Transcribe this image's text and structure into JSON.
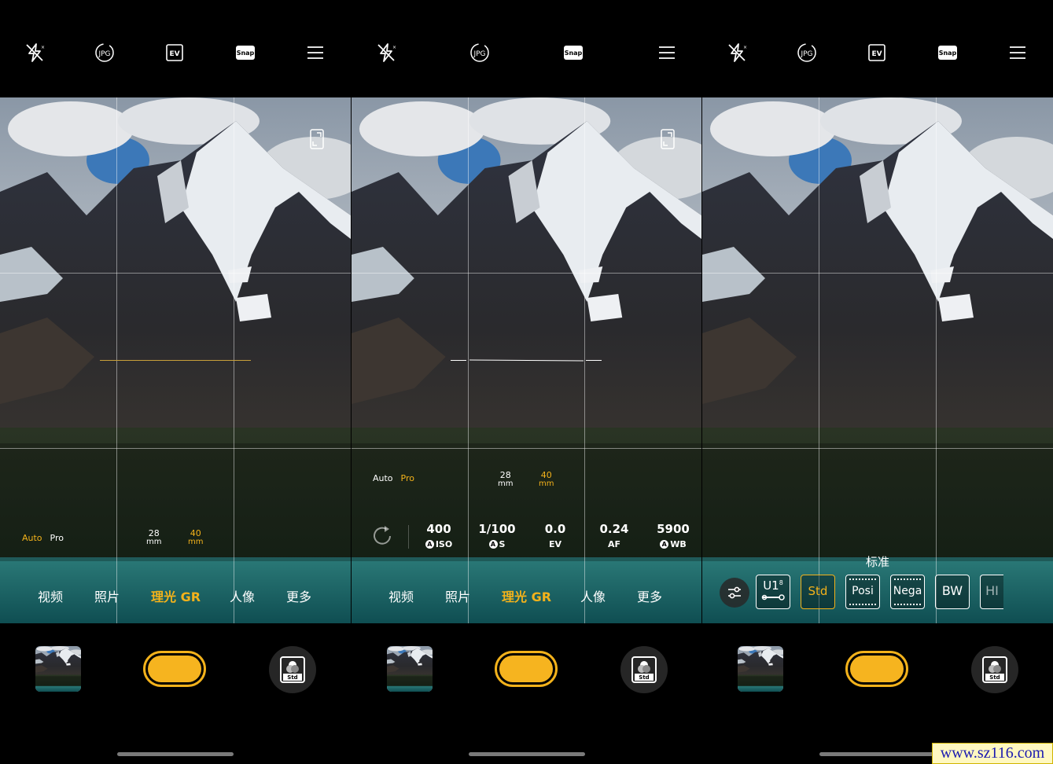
{
  "icons": {
    "top_bar": [
      "flash-off-icon",
      "jpg-format-icon",
      "ev-icon",
      "snap-icon",
      "menu-icon"
    ],
    "bottom_bar": [
      "gallery-thumbnail",
      "shutter-button",
      "film-simulation-icon"
    ]
  },
  "top_labels": {
    "jpg": "JPG",
    "ev": "EV",
    "snap": "Snap"
  },
  "panel1": {
    "modes": [
      "视频",
      "照片",
      "理光 GR",
      "人像",
      "更多"
    ],
    "active_mode": "理光 GR",
    "auto_label": "Auto",
    "pro_label": "Pro",
    "focal_a": {
      "value": "28",
      "unit": "mm"
    },
    "focal_b": {
      "value": "40",
      "unit": "mm"
    },
    "film_label": "Std"
  },
  "panel2": {
    "modes": [
      "视频",
      "照片",
      "理光 GR",
      "人像",
      "更多"
    ],
    "auto_label": "Auto",
    "pro_label": "Pro",
    "focal_a": {
      "value": "28",
      "unit": "mm"
    },
    "focal_b": {
      "value": "40",
      "unit": "mm"
    },
    "params": [
      {
        "value": "400",
        "label": "ISO",
        "auto": "A"
      },
      {
        "value": "1/100",
        "label": "S",
        "auto": "A"
      },
      {
        "value": "0.0",
        "label": "EV",
        "auto": ""
      },
      {
        "value": "0.24",
        "label": "AF",
        "auto": ""
      },
      {
        "value": "5900",
        "label": "WB",
        "auto": "A"
      }
    ],
    "film_label": "Std"
  },
  "panel3": {
    "preset_title": "标准",
    "presets": [
      "U1",
      "Std",
      "Posi",
      "Nega",
      "BW",
      "HI BW"
    ],
    "selected_preset": "Std",
    "u1_superscript": "8",
    "film_label": "Std"
  },
  "watermark": "www.sz116.com",
  "colors": {
    "accent": "#f3b21b",
    "background": "#000000"
  }
}
